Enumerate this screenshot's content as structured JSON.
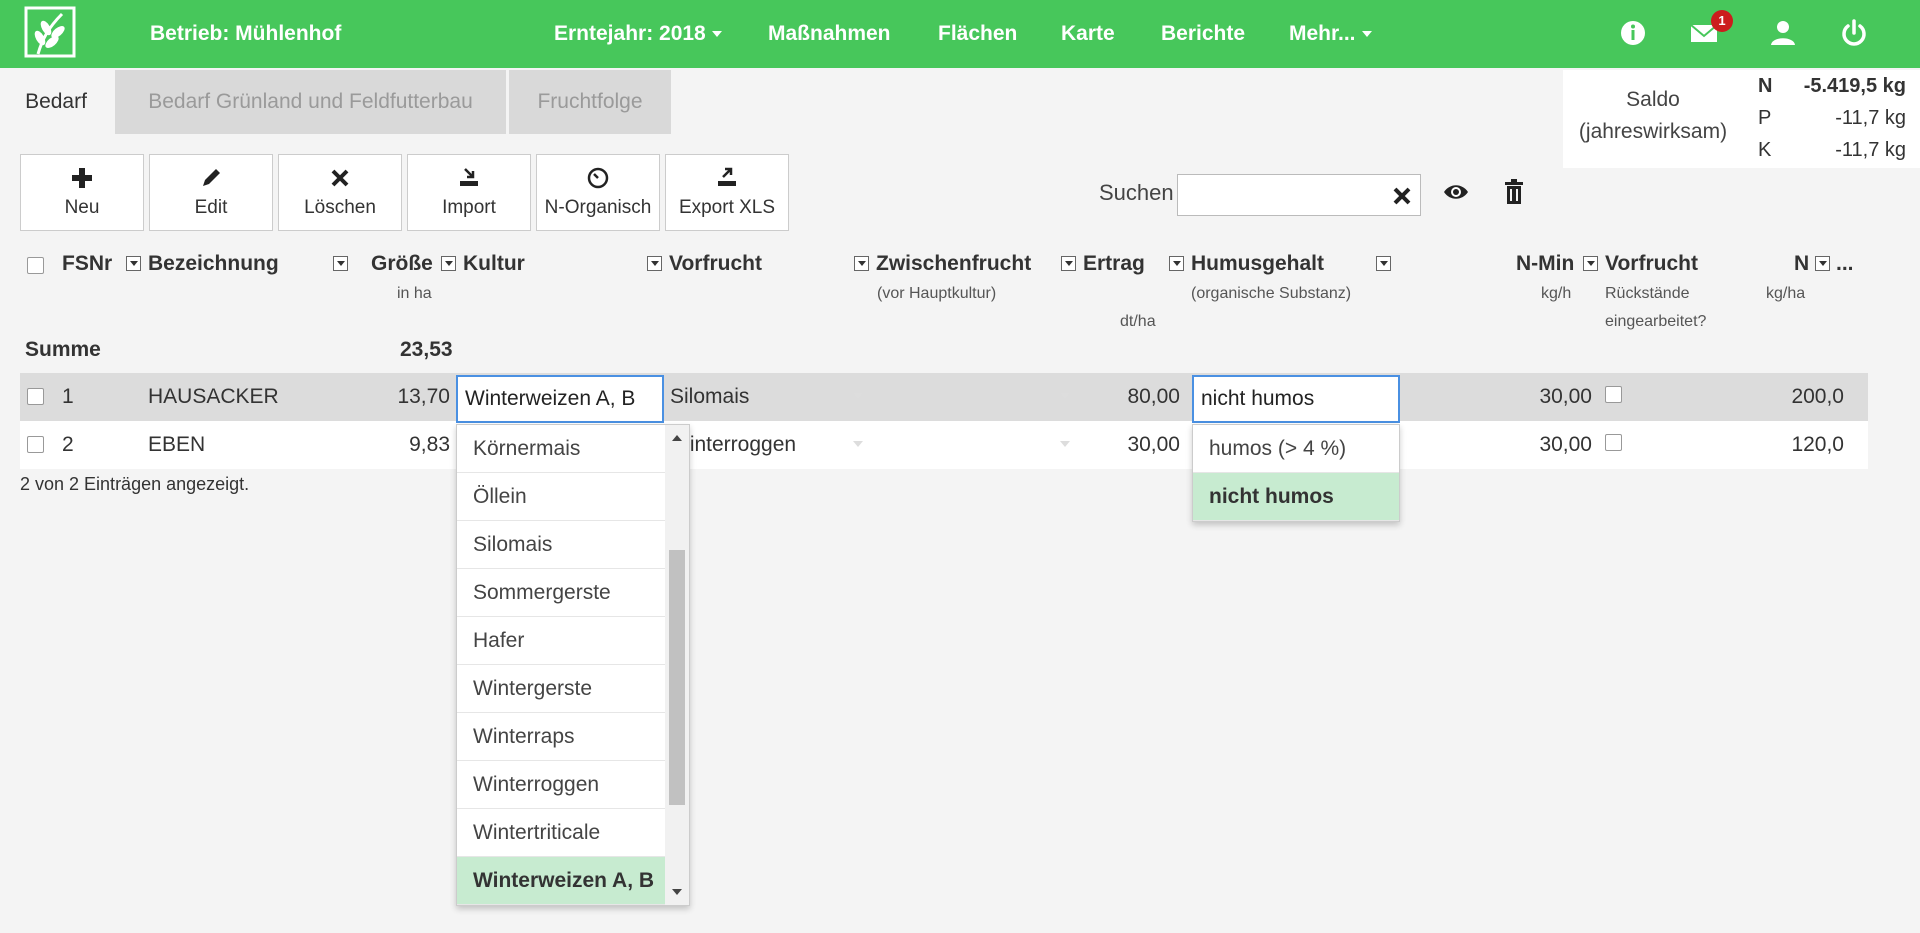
{
  "navbar": {
    "brand": "Betrieb: Mühlenhof",
    "items": [
      {
        "label": "Erntejahr: 2018",
        "dropdown": true
      },
      {
        "label": "Maßnahmen"
      },
      {
        "label": "Flächen"
      },
      {
        "label": "Karte"
      },
      {
        "label": "Berichte"
      },
      {
        "label": "Mehr...",
        "dropdown": true
      }
    ],
    "icons": [
      "info-icon",
      "envelope-icon",
      "user-icon",
      "power-icon"
    ],
    "mail_badge": "1",
    "color": "#47c75b"
  },
  "tabs": [
    "Bedarf",
    "Bedarf Grünland und Feldfutterbau",
    "Fruchtfolge"
  ],
  "saldo": {
    "label_line1": "Saldo",
    "label_line2": "(jahreswirksam)",
    "rows": [
      {
        "key": "N",
        "value": "-5.419,5 kg"
      },
      {
        "key": "P",
        "value": "-11,7 kg"
      },
      {
        "key": "K",
        "value": "-11,7 kg"
      }
    ]
  },
  "toolbar": {
    "buttons": [
      {
        "label": "Neu",
        "icon": "plus-icon"
      },
      {
        "label": "Edit",
        "icon": "pencil-icon"
      },
      {
        "label": "Löschen",
        "icon": "x-icon"
      },
      {
        "label": "Import",
        "icon": "import-icon"
      },
      {
        "label": "N-Organisch",
        "icon": "gauge-icon"
      },
      {
        "label": "Export XLS",
        "icon": "export-icon"
      }
    ],
    "search_label": "Suchen",
    "search_value": ""
  },
  "table": {
    "headers": {
      "fsnr": "FSNr",
      "bezeichnung": "Bezeichnung",
      "groesse": "Größe",
      "groesse_unit": "in ha",
      "kultur": "Kultur",
      "vorfrucht": "Vorfrucht",
      "zwischenfrucht": "Zwischenfrucht",
      "zwischenfrucht_sub": "(vor Hauptkultur)",
      "ertrag": "Ertrag",
      "ertrag_unit": "dt/ha",
      "humus": "Humusgehalt",
      "humus_sub": "(organische Substanz)",
      "nmin": "N-Min",
      "nmin_unit": "kg/h",
      "vorfrucht2": "Vorfrucht",
      "vorfrucht2_sub1": "Rückstände",
      "vorfrucht2_sub2": "eingearbeitet?",
      "n": "N",
      "n_unit": "kg/ha",
      "more": "..."
    },
    "summe_label": "Summe",
    "summe_groesse": "23,53",
    "rows": [
      {
        "fsnr": "1",
        "bezeichnung": "HAUSACKER",
        "groesse": "13,70",
        "kultur": "Winterweizen A, B",
        "vorfrucht": "Silomais",
        "zwischenfrucht": "",
        "ertrag": "80,00",
        "humus": "nicht humos",
        "nmin": "30,00",
        "n": "200,0"
      },
      {
        "fsnr": "2",
        "bezeichnung": "EBEN",
        "groesse": "9,83",
        "kultur": "",
        "vorfrucht": "Winterroggen",
        "zwischenfrucht": "",
        "ertrag": "30,00",
        "humus": "",
        "nmin": "30,00",
        "n": "120,0"
      }
    ],
    "info": "2 von 2 Einträgen angezeigt."
  },
  "kultur_dropdown": {
    "items": [
      "Körnermais",
      "Öllein",
      "Silomais",
      "Sommergerste",
      "Hafer",
      "Wintergerste",
      "Winterraps",
      "Winterroggen",
      "Wintertriticale",
      "Winterweizen A, B"
    ],
    "selected_index": 9
  },
  "humus_dropdown": {
    "items": [
      "humos (> 4 %)",
      "nicht humos"
    ],
    "selected_index": 1
  }
}
